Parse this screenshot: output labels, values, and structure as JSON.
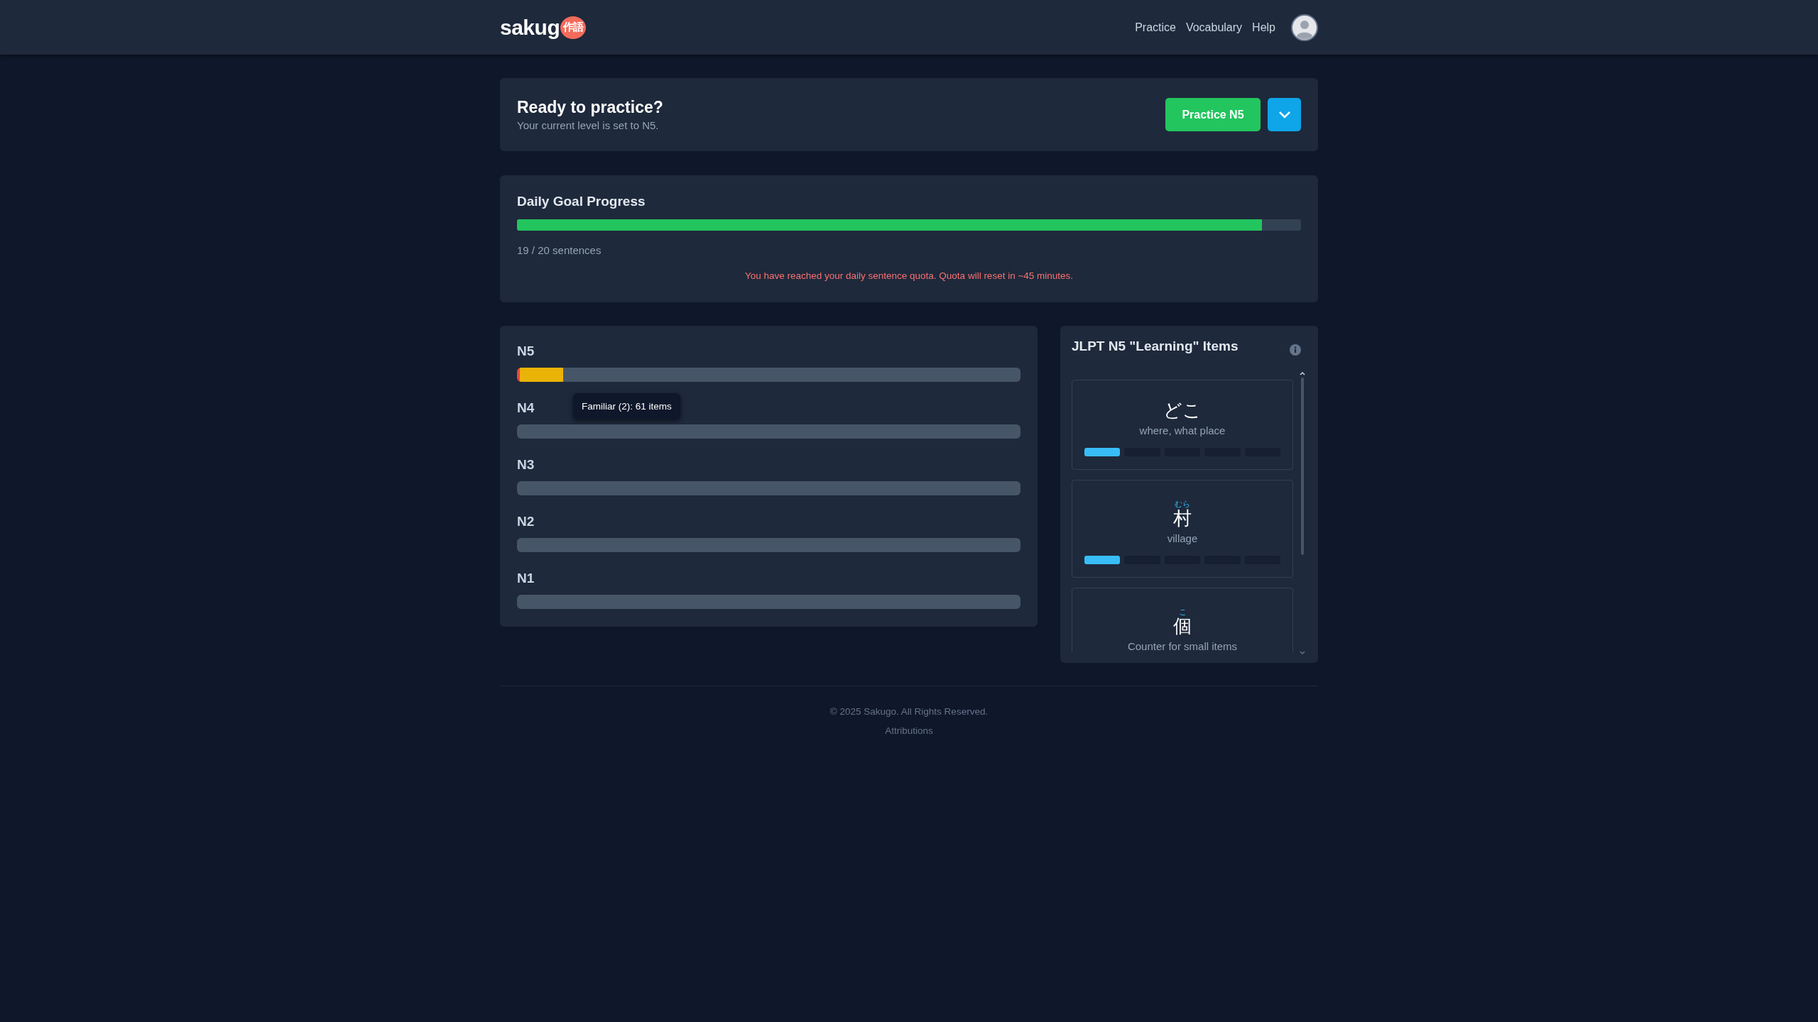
{
  "header": {
    "logo_text": "sakug",
    "logo_badge": "作語",
    "nav": [
      {
        "label": "Practice"
      },
      {
        "label": "Vocabulary"
      },
      {
        "label": "Help"
      }
    ]
  },
  "practice": {
    "title": "Ready to practice?",
    "subtitle": "Your current level is set to N5.",
    "button": "Practice N5"
  },
  "daily_goal": {
    "title": "Daily Goal Progress",
    "level": 0.95,
    "count": "19 / 20 sentences",
    "notice": "You have reached your daily sentence quota. Quota will reset in ~45 minutes."
  },
  "levels": [
    {
      "label": "N5",
      "segments": [
        {
          "color": "#ef4444",
          "level": 0.005
        },
        {
          "color": "#eab308",
          "level": 0.087
        },
        {
          "color": "#475569",
          "level": 0.908
        }
      ],
      "tooltip": "Familiar (2): 61 items"
    },
    {
      "label": "N4",
      "segments": [
        {
          "color": "#475569",
          "level": 1
        }
      ]
    },
    {
      "label": "N3",
      "segments": [
        {
          "color": "#475569",
          "level": 1
        }
      ]
    },
    {
      "label": "N2",
      "segments": [
        {
          "color": "#475569",
          "level": 1
        }
      ]
    },
    {
      "label": "N1",
      "segments": [
        {
          "color": "#475569",
          "level": 1
        }
      ]
    }
  ],
  "learning_items": {
    "title": "JLPT N5 \"Learning\" Items",
    "items": [
      {
        "word": "どこ",
        "meaning": "where, what place",
        "stages": [
          {
            "filled": true
          },
          {
            "filled": false
          },
          {
            "filled": false
          },
          {
            "filled": false
          },
          {
            "filled": false
          }
        ]
      },
      {
        "reading": "むら",
        "word": "村",
        "meaning": "village",
        "stages": [
          {
            "filled": true
          },
          {
            "filled": false
          },
          {
            "filled": false
          },
          {
            "filled": false
          },
          {
            "filled": false
          }
        ]
      },
      {
        "reading": "こ",
        "word": "個",
        "meaning": "Counter for small items"
      }
    ]
  },
  "footer": {
    "copyright": "© 2025 Sakugo. All Rights Reserved.",
    "link": "Attributions"
  }
}
